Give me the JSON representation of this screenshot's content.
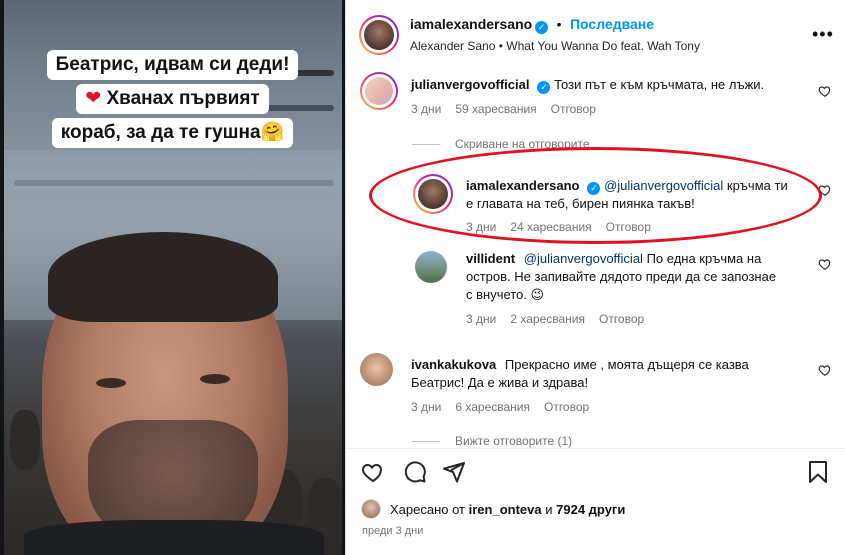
{
  "media": {
    "caption_lines": [
      "Беатрис, идвам си деди!",
      "Хванах първият",
      "кораб, за да те гушна🤗"
    ],
    "heart_glyph": "❤"
  },
  "post_header": {
    "username": "iamalexandersano",
    "follow_label": "Последване",
    "dot": "•",
    "sub_author": "Alexander Sano",
    "sub_separator": "•",
    "sub_song": "What You Wanna Do feat. Wah Tony",
    "more_glyph": "•••"
  },
  "comments": [
    {
      "username": "julianvergovofficial",
      "text": "Този път е към кръчмата, не лъжи.",
      "age": "3 дни",
      "likes": "59 харесвания",
      "reply_label": "Отговор"
    }
  ],
  "thread": {
    "hide_replies_label": "Скриване на отговорите",
    "replies": [
      {
        "username": "iamalexandersano",
        "mention": "@julianvergovofficial",
        "text_1": "кръчма ти",
        "text_2": "е главата на теб, бирен пиянка такъв!",
        "age": "3 дни",
        "likes": "24 харесвания",
        "reply_label": "Отговор"
      },
      {
        "username": "villident",
        "mention": "@julianvergovofficial",
        "text_1": "По една кръчма на",
        "text_2": "остров. Не запивайте дядото преди да се запознае",
        "text_3": "с внучето. 😉",
        "age": "3 дни",
        "likes": "2 харесвания",
        "reply_label": "Отговор"
      }
    ]
  },
  "comment_3": {
    "username": "ivankakukova",
    "text_1": "Прекрасно име , моята дъщеря се казва",
    "text_2": "Беатрис! Да е жива и здрава!",
    "age": "3 дни",
    "likes": "6 харесвания",
    "reply_label": "Отговор",
    "view_replies_label": "Вижте отговорите (1)"
  },
  "footer": {
    "liked_by_prefix": "Харесано от",
    "liked_by_user": "iren_onteva",
    "liked_by_and": "и",
    "liked_by_count": "7924 други",
    "date": "преди 3 дни"
  },
  "colors": {
    "accent": "#0095f6",
    "highlight_ellipse": "#e3101f",
    "secondary_text": "#737373"
  },
  "icons": [
    "more-options-icon",
    "verified-badge-icon",
    "heart-icon",
    "comment-icon",
    "share-icon",
    "bookmark-icon"
  ]
}
